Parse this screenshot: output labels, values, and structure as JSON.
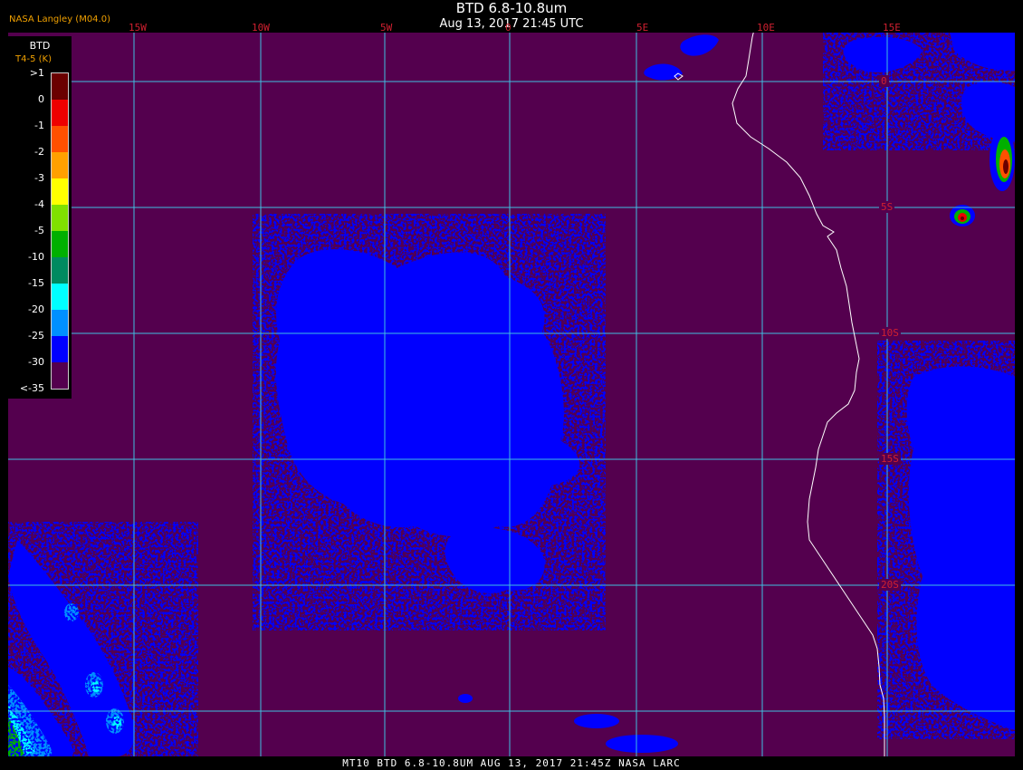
{
  "title": "BTD 6.8-10.8um",
  "date": "Aug 13, 2017 21:45 UTC",
  "credit": "NASA Langley (M04.0)",
  "footer": "MT10  BTD 6.8-10.8UM  AUG 13, 2017 21:45Z  NASA LARC",
  "longitude_labels": [
    "15W",
    "10W",
    "5W",
    "0",
    "5E",
    "10E",
    "15E"
  ],
  "latitude_labels": [
    "0",
    "5S",
    "10S",
    "15S",
    "20S"
  ],
  "legend": {
    "title": "BTD",
    "unit": "T4-5 (K)",
    "labels": [
      ">1",
      "0",
      "-1",
      "-2",
      "-3",
      "-4",
      "-5",
      "-10",
      "-15",
      "-20",
      "-25",
      "-30",
      "<-35"
    ],
    "colors": [
      "#6a0000",
      "#ee0000",
      "#ff5000",
      "#ffa000",
      "#ffff00",
      "#80e000",
      "#00b000",
      "#008a60",
      "#00ffff",
      "#0090ff",
      "#0000ff",
      "#54004e"
    ]
  },
  "colors": {
    "background": "#54004e",
    "grid": "#40c0e0",
    "cloud": "#0000ff",
    "coast": "#ffffff"
  }
}
